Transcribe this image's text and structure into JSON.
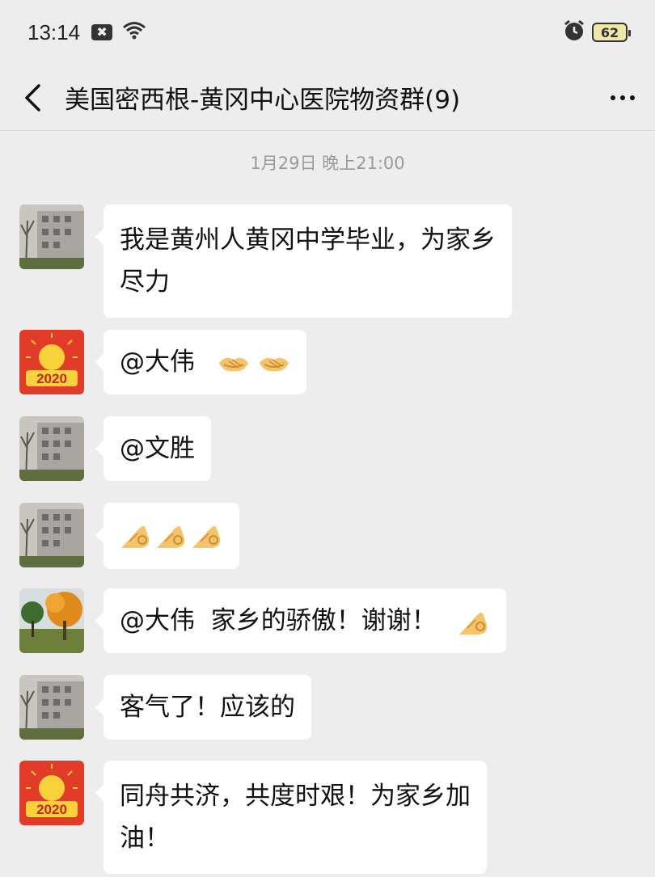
{
  "status": {
    "time": "13:14",
    "notification_badge": "✖",
    "battery": "62"
  },
  "header": {
    "title": "美国密西根-黄冈中心医院物资群(9)"
  },
  "timestamp": "1月29日 晚上21:00",
  "messages": [
    {
      "text": "我是黄州人黄冈中学毕业，为家乡尽力",
      "line1": "我是黄州人黄冈中学毕业，为家乡",
      "line2": "尽力",
      "avatar": "building-photo"
    },
    {
      "text": "@大伟",
      "emojis": [
        "handshake",
        "handshake"
      ],
      "avatar": "2020-logo"
    },
    {
      "text": "@文胜",
      "avatar": "building-photo"
    },
    {
      "text": "",
      "emojis": [
        "ok-hand",
        "ok-hand",
        "ok-hand"
      ],
      "avatar": "building-photo"
    },
    {
      "text": "@大伟  家乡的骄傲！谢谢！",
      "emojis": [
        "ok-hand"
      ],
      "avatar": "autumn-tree-photo"
    },
    {
      "text": "客气了！应该的",
      "avatar": "building-photo"
    },
    {
      "text": "同舟共济，共度时艰！为家乡加油！",
      "line1": "同舟共济，共度时艰！为家乡加",
      "line2": "油！",
      "avatar": "2020-logo"
    }
  ]
}
